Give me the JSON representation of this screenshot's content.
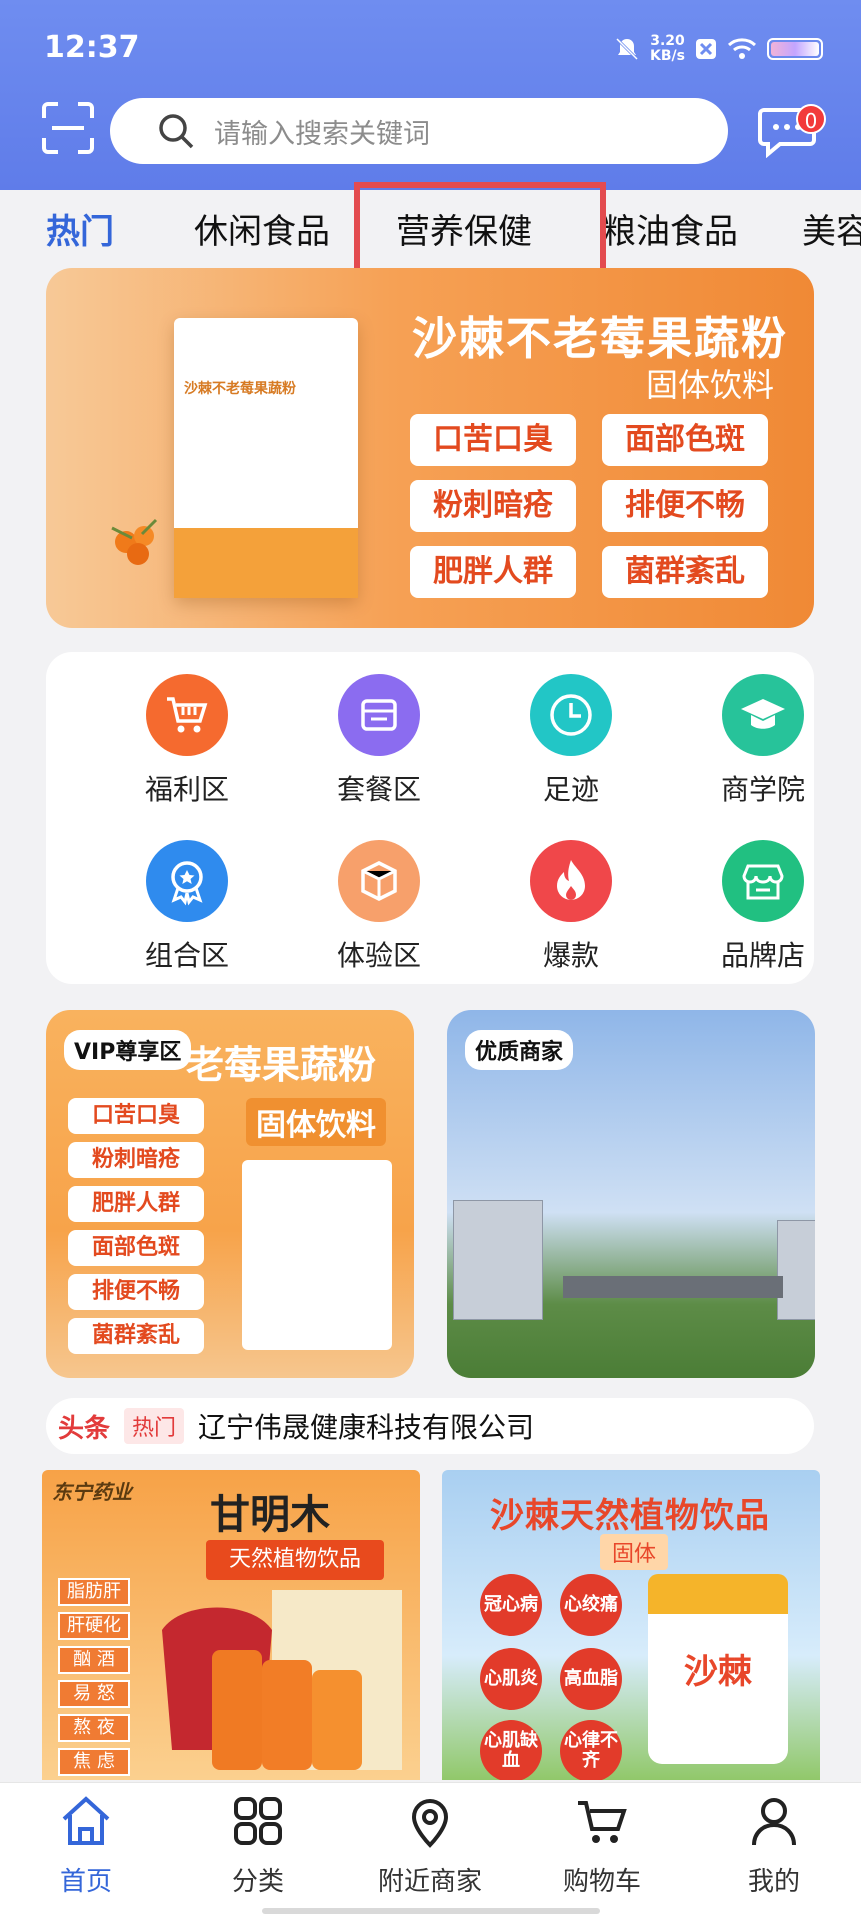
{
  "status": {
    "time": "12:37",
    "speed": "3.20",
    "speed_unit": "KB/s"
  },
  "search": {
    "placeholder": "请输入搜索关键词"
  },
  "message": {
    "badge": "0"
  },
  "tabs": [
    {
      "label": "热门",
      "active": true
    },
    {
      "label": "休闲食品",
      "active": false
    },
    {
      "label": "营养保健",
      "active": false
    },
    {
      "label": "粮油食品",
      "active": false
    },
    {
      "label": "美容",
      "active": false
    }
  ],
  "banner": {
    "title": "沙棘不老莓果蔬粉",
    "subtitle": "固体饮料",
    "tags": [
      "口苦口臭",
      "面部色斑",
      "粉刺暗疮",
      "排便不畅",
      "肥胖人群",
      "菌群紊乱"
    ],
    "box_label": "沙棘不老莓果蔬粉",
    "dots": 15,
    "active_dot": 0
  },
  "grid": [
    {
      "label": "福利区",
      "icon": "cart-icon",
      "color": "#f56a2f"
    },
    {
      "label": "套餐区",
      "icon": "package-icon",
      "color": "#8b6cf0"
    },
    {
      "label": "足迹",
      "icon": "clock-icon",
      "color": "#22c6c6"
    },
    {
      "label": "商学院",
      "icon": "graduation-cap-icon",
      "color": "#27c39a"
    },
    {
      "label": "组合区",
      "icon": "medal-icon",
      "color": "#2f8bee"
    },
    {
      "label": "体验区",
      "icon": "cube-icon",
      "color": "#f7a06b"
    },
    {
      "label": "爆款",
      "icon": "fire-icon",
      "color": "#f0474a"
    },
    {
      "label": "品牌店",
      "icon": "store-icon",
      "color": "#21c081"
    }
  ],
  "cards": {
    "left": {
      "badge": "VIP尊享区",
      "title": "老莓果蔬粉",
      "subtitle": "固体饮料",
      "tags": [
        "口苦口臭",
        "粉刺暗疮",
        "肥胖人群",
        "面部色斑",
        "排便不畅",
        "菌群紊乱"
      ]
    },
    "right": {
      "badge": "优质商家"
    }
  },
  "news": {
    "head": "头条",
    "hot": "热门",
    "text": "辽宁伟晟健康科技有限公司"
  },
  "products": {
    "left": {
      "logo": "东宁药业",
      "title": "甘明木",
      "subtitle": "天然植物饮品",
      "tags": [
        "脂肪肝",
        "肝硬化",
        "酗  酒",
        "易  怒",
        "熬  夜",
        "焦  虑"
      ]
    },
    "right": {
      "title": "沙棘天然植物饮品",
      "subtitle": "固体",
      "bubbles": [
        "冠心病",
        "心绞痛",
        "心肌炎",
        "高血脂",
        "心肌缺血",
        "心律不齐"
      ],
      "jar_label": "沙棘"
    }
  },
  "nav": [
    {
      "label": "首页",
      "icon": "home-icon",
      "active": true
    },
    {
      "label": "分类",
      "icon": "category-grid-icon",
      "active": false
    },
    {
      "label": "附近商家",
      "icon": "location-pin-icon",
      "active": false
    },
    {
      "label": "购物车",
      "icon": "shopping-cart-icon",
      "active": false
    },
    {
      "label": "我的",
      "icon": "user-icon",
      "active": false
    }
  ],
  "colors": {
    "primary": "#3466d9",
    "header": "#6a88ee",
    "accent": "#f08935",
    "badge": "#f23a3a"
  }
}
